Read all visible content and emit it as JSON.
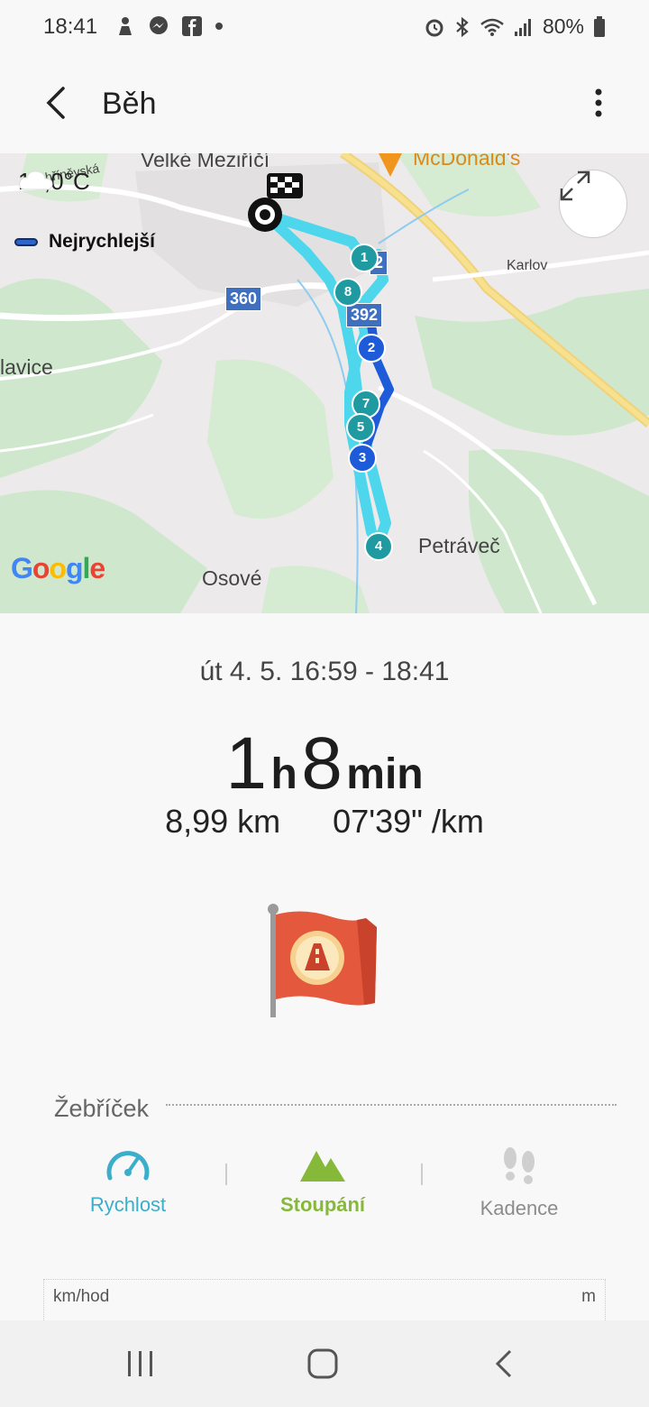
{
  "status_bar": {
    "time": "18:41",
    "battery": "80%",
    "left_icons": [
      "notification-icon",
      "messenger-icon",
      "facebook-icon",
      "dot-icon"
    ],
    "right_icons": [
      "alarm-icon",
      "bluetooth-icon",
      "wifi-icon",
      "signal-icon",
      "battery-icon"
    ]
  },
  "app_bar": {
    "title": "Běh"
  },
  "map": {
    "weather": "18,0°C",
    "legend": "Nejrychlejší",
    "google": "Google",
    "labels": {
      "town_top": "Velké Meziříčí",
      "mcdonalds": "McDonald's",
      "karlov": "Karlov",
      "lavice": "lavice",
      "petravec": "Petráveč",
      "osove": "Osové",
      "small_street": "ohříněvská"
    },
    "road_shields": [
      "360",
      "392",
      "2"
    ],
    "markers": [
      "1",
      "8",
      "2",
      "7",
      "5",
      "3",
      "4"
    ]
  },
  "workout": {
    "date_range": "út 4. 5. 16:59 - 18:41",
    "duration_hours": "1",
    "duration_h_unit": "h",
    "duration_minutes": "8",
    "duration_min_unit": "min",
    "distance": "8,99 km",
    "pace": "07'39\" /km"
  },
  "ladder": {
    "title": "Žebříček"
  },
  "tabs": [
    {
      "label": "Rychlost",
      "color": "#3aaecb"
    },
    {
      "label": "Stoupání",
      "color": "#86b93a"
    },
    {
      "label": "Kadence",
      "color": "#8c8c8c"
    }
  ],
  "chart": {
    "left_unit": "km/hod",
    "right_unit": "m"
  },
  "colors": {
    "route_light": "#4dd6ec",
    "route_dark": "#1e5bd8",
    "marker_teal": "#1e9aa0",
    "marker_blue": "#1e5bd8",
    "flag_red": "#e4593d"
  }
}
